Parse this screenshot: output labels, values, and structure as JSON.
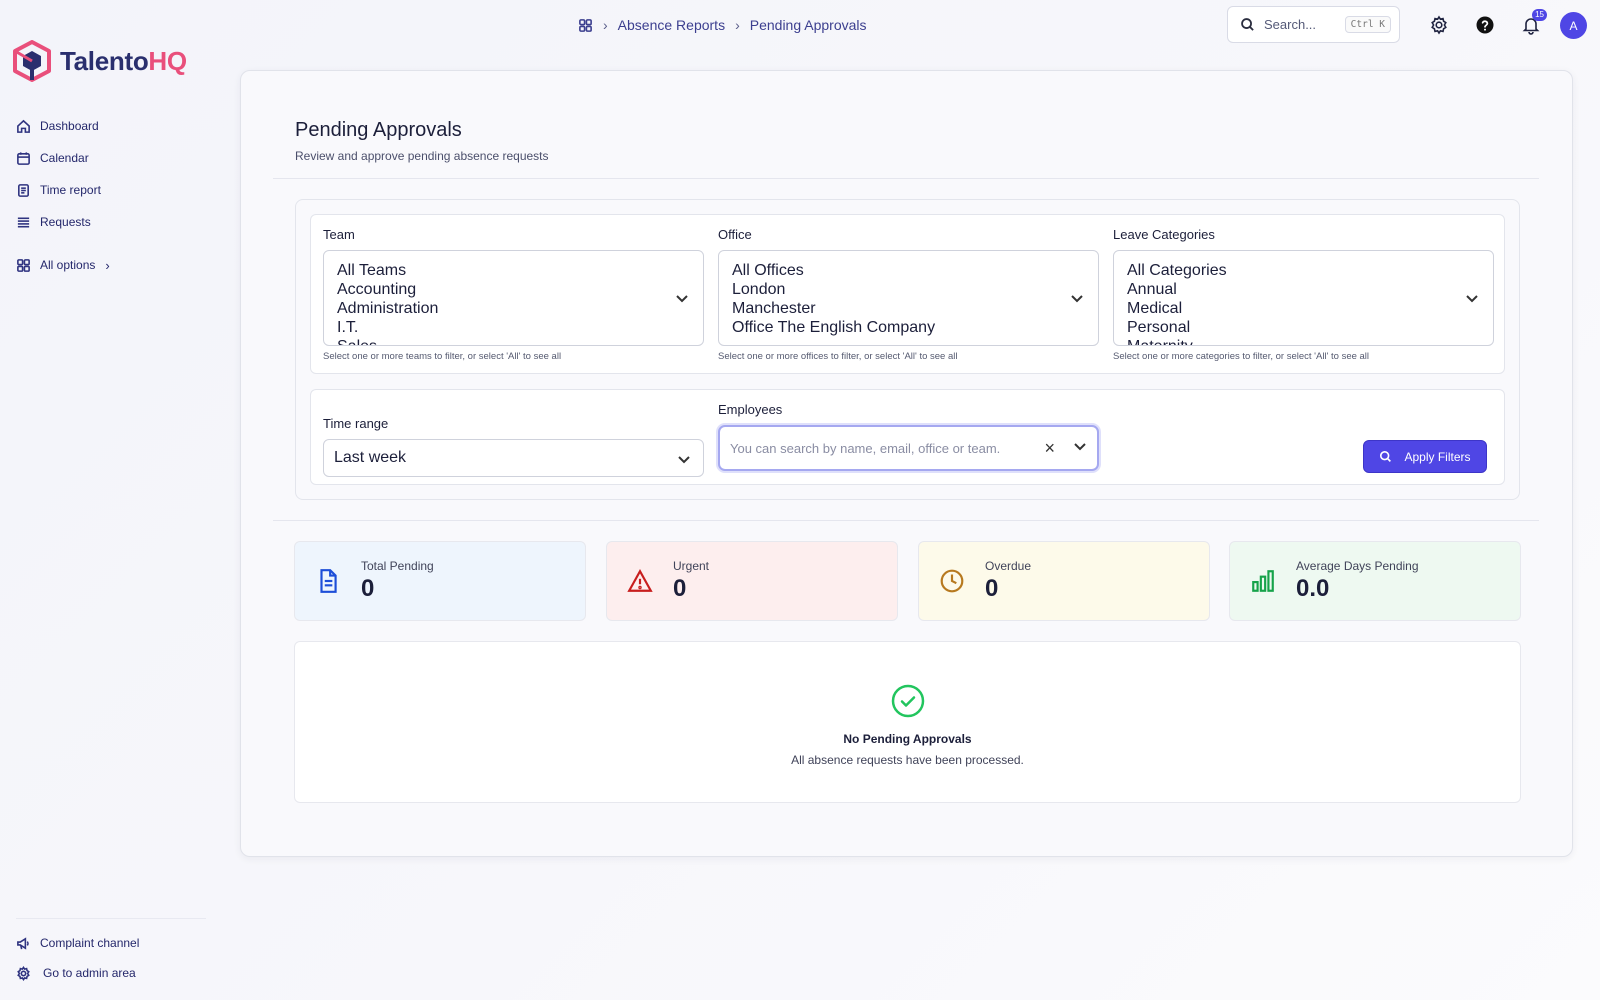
{
  "app": {
    "name_part1": "Talento",
    "name_part2": "HQ"
  },
  "sidebar": {
    "items": [
      {
        "label": "Dashboard",
        "icon": "home-icon"
      },
      {
        "label": "Calendar",
        "icon": "calendar-icon"
      },
      {
        "label": "Time report",
        "icon": "report-icon"
      },
      {
        "label": "Requests",
        "icon": "list-icon"
      }
    ],
    "all_options": "All options",
    "all_options_chevron": "›",
    "bottom": [
      {
        "label": "Complaint channel",
        "icon": "megaphone-icon"
      },
      {
        "label": "Go to admin area",
        "icon": "gear-icon"
      }
    ]
  },
  "breadcrumb": {
    "items": [
      "Absence Reports",
      "Pending Approvals"
    ],
    "separator": "›"
  },
  "search": {
    "placeholder": "Search...",
    "shortcut": "Ctrl K"
  },
  "notifications": {
    "count": "15"
  },
  "user": {
    "avatar_initial": "A"
  },
  "page": {
    "title": "Pending Approvals",
    "subtitle": "Review and approve pending absence requests"
  },
  "filters": {
    "team": {
      "label": "Team",
      "options": [
        "All Teams",
        "Accounting",
        "Administration",
        "I.T.",
        "Sales"
      ],
      "help": "Select one or more teams to filter, or select 'All' to see all"
    },
    "office": {
      "label": "Office",
      "options": [
        "All Offices",
        "London",
        "Manchester",
        "Office The English Company"
      ],
      "help": "Select one or more offices to filter, or select 'All' to see all"
    },
    "categories": {
      "label": "Leave Categories",
      "options": [
        "All Categories",
        "Annual",
        "Medical",
        "Personal",
        "Maternity"
      ],
      "help": "Select one or more categories to filter, or select 'All' to see all"
    },
    "time_range": {
      "label": "Time range",
      "value": "Last week"
    },
    "employees": {
      "label": "Employees",
      "placeholder": "You can search by name, email, office or team.",
      "clear": "×"
    },
    "apply_label": "Apply Filters"
  },
  "stats": [
    {
      "label": "Total Pending",
      "value": "0",
      "color": "#1d4ed8",
      "bg": "#eef5fd",
      "icon": "document-icon"
    },
    {
      "label": "Urgent",
      "value": "0",
      "color": "#c81e1e",
      "bg": "#fdeeee",
      "icon": "warning-icon"
    },
    {
      "label": "Overdue",
      "value": "0",
      "color": "#b7791f",
      "bg": "#fdfaea",
      "icon": "clock-icon"
    },
    {
      "label": "Average Days Pending",
      "value": "0.0",
      "color": "#16a34a",
      "bg": "#eef9f1",
      "icon": "bar-chart-icon"
    }
  ],
  "empty_state": {
    "title": "No Pending Approvals",
    "message": "All absence requests have been processed."
  },
  "colors": {
    "accent": "#4f46e5",
    "brand_dark": "#2a2f6e",
    "brand_pink": "#e94f7b"
  }
}
